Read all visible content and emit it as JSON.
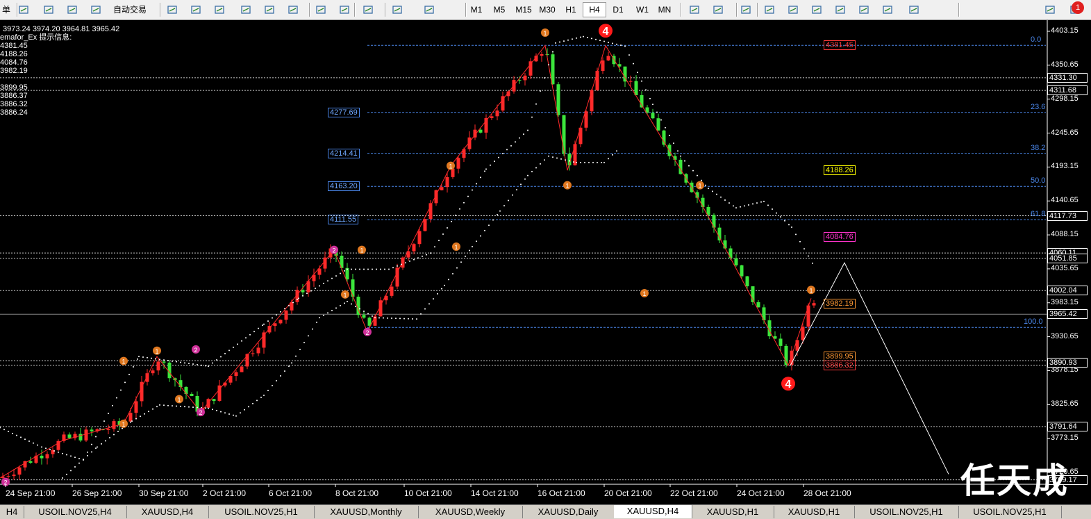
{
  "toolbar": {
    "menu_fragment": "单",
    "auto_trade_label": "自动交易",
    "timeframes": [
      "M1",
      "M5",
      "M15",
      "M30",
      "H1",
      "H4",
      "D1",
      "W1",
      "MN"
    ],
    "active_timeframe": "H4",
    "icons": [
      "folder-icon",
      "profiles-icon",
      "market-watch-icon",
      "autotrade-icon",
      "bar-chart-icon",
      "candle-chart-icon",
      "line-chart-icon",
      "zoom-in-icon",
      "zoom-out-icon",
      "tile-icon",
      "autoscroll-icon",
      "chart-shift-icon",
      "indicators-icon",
      "periods-icon",
      "templates-icon",
      "cursor-icon",
      "crosshair-icon",
      "vertical-line-icon",
      "horizontal-line-icon",
      "trendline-icon",
      "fib-fan-icon",
      "fib-retracement-icon",
      "text-icon",
      "text-label-icon",
      "arrows-icon",
      "search-icon",
      "alerts-icon"
    ],
    "alert_badge": "1"
  },
  "info": {
    "ohlc": "3973.24 3974.20 3964.81 3965.42",
    "indicator_title": "emafor_Ex 提示信息:",
    "values": [
      "4381.45",
      "4188.26",
      "4084.76",
      "3982.19",
      "",
      "3899.95",
      "3886.37",
      "3886.32",
      "3886.24"
    ]
  },
  "y_axis": {
    "labels": [
      {
        "t": "4403.15",
        "v": 4403.15
      },
      {
        "t": "4350.65",
        "v": 4350.65
      },
      {
        "t": "4298.15",
        "v": 4298.15
      },
      {
        "t": "4245.65",
        "v": 4245.65
      },
      {
        "t": "4193.15",
        "v": 4193.15
      },
      {
        "t": "4140.65",
        "v": 4140.65
      },
      {
        "t": "4088.15",
        "v": 4088.15
      },
      {
        "t": "4035.65",
        "v": 4035.65
      },
      {
        "t": "3983.15",
        "v": 3983.15
      },
      {
        "t": "3930.65",
        "v": 3930.65
      },
      {
        "t": "3878.15",
        "v": 3878.15
      },
      {
        "t": "3825.65",
        "v": 3825.65
      },
      {
        "t": "3773.15",
        "v": 3773.15
      },
      {
        "t": "3720.65",
        "v": 3720.65
      }
    ],
    "boxed": [
      {
        "t": "4331.30",
        "v": 4331.3
      },
      {
        "t": "4311.68",
        "v": 4311.68
      },
      {
        "t": "4117.73",
        "v": 4117.73
      },
      {
        "t": "4060.11",
        "v": 4060.11
      },
      {
        "t": "4051.85",
        "v": 4051.85
      },
      {
        "t": "4002.04",
        "v": 4002.04
      },
      {
        "t": "3965.42",
        "v": 3965.42
      },
      {
        "t": "3890.93",
        "v": 3890.93
      },
      {
        "t": "3791.64",
        "v": 3791.64
      },
      {
        "t": "3709.17",
        "v": 3709.17
      }
    ]
  },
  "x_axis": [
    "24 Sep 21:00",
    "26 Sep 21:00",
    "30 Sep 21:00",
    "2 Oct 21:00",
    "6 Oct 21:00",
    "8 Oct 21:00",
    "10 Oct 21:00",
    "14 Oct 21:00",
    "16 Oct 21:00",
    "20 Oct 21:00",
    "22 Oct 21:00",
    "24 Oct 21:00",
    "28 Oct 21:00"
  ],
  "fib_levels": [
    {
      "pct": "0.0",
      "v": 4381.45
    },
    {
      "pct": "23.6",
      "v": 4277.69
    },
    {
      "pct": "38.2",
      "v": 4214.41
    },
    {
      "pct": "50.0",
      "v": 4163.2
    },
    {
      "pct": "61.8",
      "v": 4111.55
    },
    {
      "pct": "100.0",
      "v": 3945.0
    }
  ],
  "fib_price_tags": [
    "4277.69",
    "4214.41",
    "4163.20",
    "4111.55"
  ],
  "semafor_tags": [
    {
      "t": "4381.45",
      "color": "#ff3b3b",
      "v": 4381.45
    },
    {
      "t": "4188.26",
      "color": "#ffff00",
      "v": 4188.26
    },
    {
      "t": "4084.76",
      "color": "#ff33cc",
      "v": 4084.76
    },
    {
      "t": "3982.19",
      "color": "#ff9933",
      "v": 3982.19
    },
    {
      "t": "3899.95",
      "color": "#ff9933",
      "v": 3899.95
    },
    {
      "t": "3886.32",
      "color": "#ff3b3b",
      "v": 3886.32
    }
  ],
  "dotted_levels": [
    4331.3,
    4311.68,
    4117.73,
    4060.11,
    4051.85,
    4002.04,
    3893.5,
    3886.5,
    3791.64,
    3709.17
  ],
  "current_price": 3965.42,
  "markers": [
    {
      "x": 178,
      "v": 3893,
      "l": "1",
      "c": "#e07820"
    },
    {
      "x": 178,
      "v": 3796,
      "l": "1",
      "c": "#e07820"
    },
    {
      "x": 226,
      "v": 3909,
      "l": "1",
      "c": "#e07820"
    },
    {
      "x": 258,
      "v": 3834,
      "l": "1",
      "c": "#e07820"
    },
    {
      "x": 282,
      "v": 3911,
      "l": "2",
      "c": "#d0309a"
    },
    {
      "x": 289,
      "v": 3814,
      "l": "2",
      "c": "#d0309a"
    },
    {
      "x": 481,
      "v": 4065,
      "l": "2",
      "c": "#d0309a"
    },
    {
      "x": 521,
      "v": 4065,
      "l": "1",
      "c": "#e07820"
    },
    {
      "x": 497,
      "v": 3996,
      "l": "1",
      "c": "#e07820"
    },
    {
      "x": 529,
      "v": 3938,
      "l": "2",
      "c": "#d0309a"
    },
    {
      "x": 649,
      "v": 4195,
      "l": "1",
      "c": "#e07820"
    },
    {
      "x": 657,
      "v": 4070,
      "l": "1",
      "c": "#e07820"
    },
    {
      "x": 785,
      "v": 4401,
      "l": "1",
      "c": "#e07820"
    },
    {
      "x": 817,
      "v": 4165,
      "l": "1",
      "c": "#e07820"
    },
    {
      "x": 1008,
      "v": 4165,
      "l": "1",
      "c": "#e07820"
    },
    {
      "x": 928,
      "v": 3998,
      "l": "1",
      "c": "#e07820"
    },
    {
      "x": 1168,
      "v": 4003,
      "l": "1",
      "c": "#e07820"
    },
    {
      "x": 8,
      "v": 3706,
      "l": "2",
      "c": "#d0309a"
    }
  ],
  "big_markers": [
    {
      "x": 872,
      "v": 4404,
      "l": "4"
    },
    {
      "x": 1135,
      "v": 3858,
      "l": "4"
    }
  ],
  "tabs": [
    "H4",
    "USOIL.NOV25,H4",
    "XAUUSD,H4",
    "USOIL.NOV25,H1",
    "XAUUSD,Monthly",
    "XAUUSD,Weekly",
    "XAUUSD,Daily",
    "XAUUSD,H4",
    "XAUUSD,H1",
    "XAUUSD,H1",
    "USOIL.NOV25,H1",
    "USOIL.NOV25,H1"
  ],
  "active_tab_index": 7,
  "watermark": "任天成",
  "chart_data": {
    "type": "candlestick",
    "symbol_timeframe": "XAUUSD,H4",
    "ylim": [
      3700,
      4410
    ],
    "zigzag": [
      [
        0,
        3712
      ],
      [
        90,
        3770
      ],
      [
        178,
        3796
      ],
      [
        226,
        3900
      ],
      [
        289,
        3814
      ],
      [
        481,
        4065
      ],
      [
        529,
        3938
      ],
      [
        649,
        4195
      ],
      [
        785,
        4381
      ],
      [
        817,
        4188
      ],
      [
        872,
        4381
      ],
      [
        1008,
        4140
      ],
      [
        1135,
        3886
      ],
      [
        1168,
        3990
      ]
    ],
    "projection": [
      [
        1138,
        3886
      ],
      [
        1216,
        4045
      ],
      [
        1366,
        3718
      ]
    ],
    "sar_high": [
      [
        0,
        3790
      ],
      [
        60,
        3760
      ],
      [
        120,
        3740
      ],
      [
        200,
        3900
      ],
      [
        300,
        3885
      ],
      [
        380,
        3950
      ],
      [
        430,
        3990
      ],
      [
        500,
        4035
      ],
      [
        560,
        4035
      ],
      [
        620,
        4060
      ],
      [
        700,
        4190
      ],
      [
        760,
        4250
      ],
      [
        800,
        4385
      ],
      [
        840,
        4395
      ],
      [
        900,
        4380
      ],
      [
        940,
        4290
      ],
      [
        980,
        4210
      ],
      [
        1020,
        4160
      ],
      [
        1060,
        4130
      ],
      [
        1100,
        4140
      ],
      [
        1140,
        4100
      ],
      [
        1175,
        4035
      ]
    ],
    "sar_low": [
      [
        90,
        3712
      ],
      [
        140,
        3760
      ],
      [
        190,
        3800
      ],
      [
        230,
        3825
      ],
      [
        300,
        3820
      ],
      [
        340,
        3808
      ],
      [
        380,
        3840
      ],
      [
        420,
        3890
      ],
      [
        460,
        3960
      ],
      [
        500,
        3985
      ],
      [
        540,
        3960
      ],
      [
        600,
        3958
      ],
      [
        640,
        4010
      ],
      [
        680,
        4070
      ],
      [
        720,
        4125
      ],
      [
        760,
        4180
      ],
      [
        790,
        4210
      ],
      [
        830,
        4200
      ],
      [
        870,
        4200
      ],
      [
        890,
        4220
      ]
    ]
  }
}
